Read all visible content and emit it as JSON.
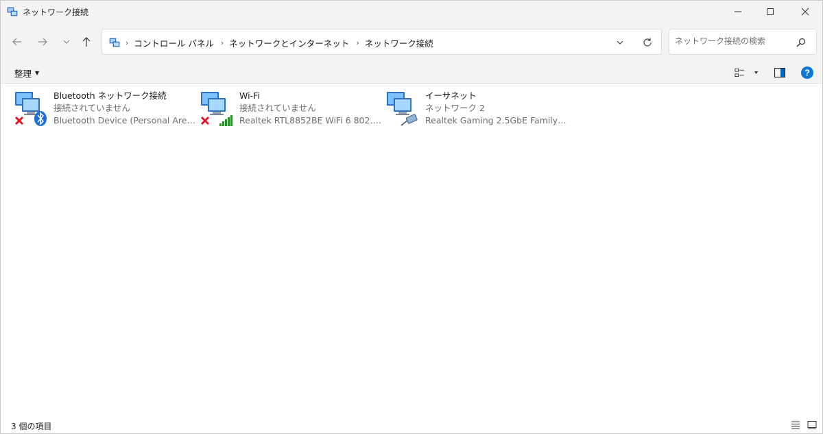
{
  "window": {
    "title": "ネットワーク接続",
    "controls": [
      "minimize-icon",
      "maximize-icon",
      "close-icon"
    ]
  },
  "nav": {
    "breadcrumbs": [
      "コントロール パネル",
      "ネットワークとインターネット",
      "ネットワーク接続"
    ],
    "search": {
      "placeholder": "ネットワーク接続の検索"
    }
  },
  "toolbar": {
    "organize_label": "整理"
  },
  "connections": [
    {
      "name": "Bluetooth ネットワーク接続",
      "status": "接続されていません",
      "device": "Bluetooth Device (Personal Area ...",
      "icon": "bluetooth-network-icon",
      "disconnected": true
    },
    {
      "name": "Wi-Fi",
      "status": "接続されていません",
      "device": "Realtek RTL8852BE WiFi 6 802.11a...",
      "icon": "wifi-network-icon",
      "disconnected": true
    },
    {
      "name": "イーサネット",
      "status": "ネットワーク 2",
      "device": "Realtek Gaming 2.5GbE Family Co...",
      "icon": "ethernet-network-icon",
      "disconnected": false
    }
  ],
  "statusbar": {
    "item_count": "3 個の項目"
  },
  "colors": {
    "accent": "#0067c0",
    "chrome": "#f3f3f3",
    "error": "#e81123",
    "signal": "#2e8b2e"
  }
}
